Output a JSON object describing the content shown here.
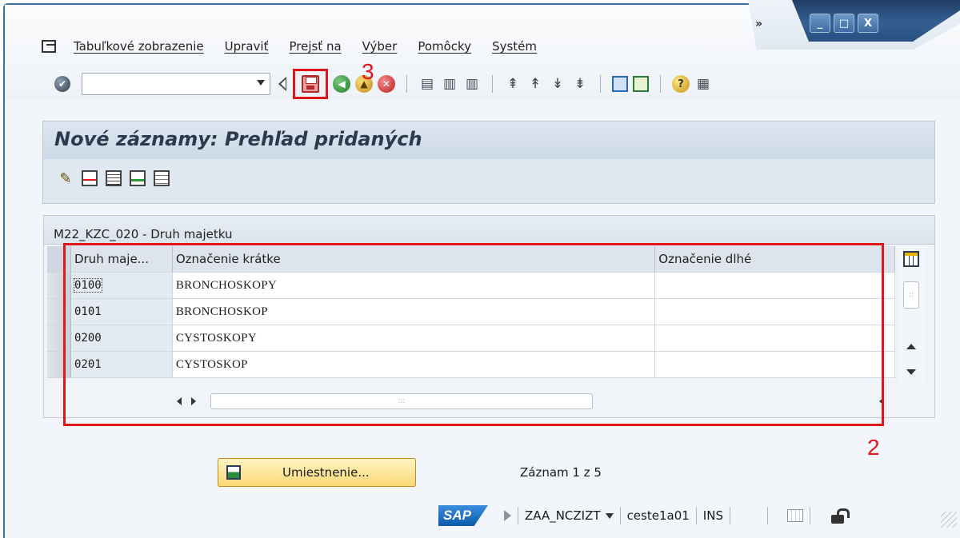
{
  "window": {
    "overflow_label": "»",
    "controls": {
      "minimize": "_",
      "maximize": "□",
      "close": "X"
    }
  },
  "menubar": {
    "items": [
      "Tabuľkové zobrazenie",
      "Upraviť",
      "Prejsť na",
      "Výber",
      "Pomôcky",
      "Systém"
    ]
  },
  "toolbar": {
    "okcode_value": "",
    "annotation_save": "3"
  },
  "screen": {
    "title": "Nové záznamy: Prehľad pridaných"
  },
  "table": {
    "title": "M22_KZC_020 - Druh majetku",
    "columns": [
      "Druh maje...",
      "Označenie krátke",
      "Označenie dlhé"
    ],
    "rows": [
      {
        "code": "0100",
        "short": "BRONCHOSKOPY",
        "long": ""
      },
      {
        "code": "0101",
        "short": "BRONCHOSKOP",
        "long": ""
      },
      {
        "code": "0200",
        "short": "CYSTOSKOPY",
        "long": ""
      },
      {
        "code": "0201",
        "short": "CYSTOSKOP",
        "long": ""
      }
    ],
    "annotation": "2"
  },
  "bottom": {
    "position_button": "Umiestnenie...",
    "record_info": "Záznam 1 z 5"
  },
  "statusbar": {
    "logo": "SAP",
    "system": "ZAA_NCZIZT",
    "server": "ceste1a01",
    "mode": "INS"
  },
  "colors": {
    "annotation_red": "#e0161b",
    "title_band": "#cdd9e6",
    "button_yellow": "#fbd977"
  }
}
